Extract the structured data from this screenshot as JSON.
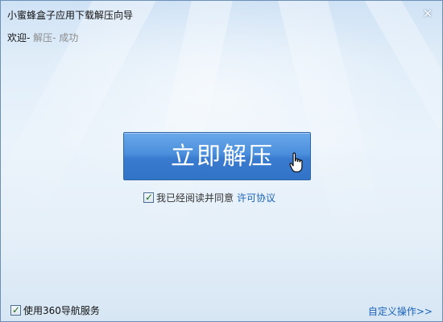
{
  "window": {
    "title": "小蜜蜂盒子应用下载解压向导",
    "close_icon": "close-icon"
  },
  "steps": {
    "active": "欢迎-",
    "inactive": " 解压- 成功"
  },
  "main": {
    "extract_label": "立即解压",
    "cursor_icon": "hand-pointer-icon"
  },
  "agreement": {
    "checked": true,
    "text": "我已经阅读并同意",
    "link": "许可协议"
  },
  "footer": {
    "nav_service_checked": true,
    "nav_service_text": "使用360导航服务",
    "custom_link": "自定义操作>>"
  },
  "colors": {
    "button": "#3a7bcf",
    "link": "#1b63b8"
  }
}
